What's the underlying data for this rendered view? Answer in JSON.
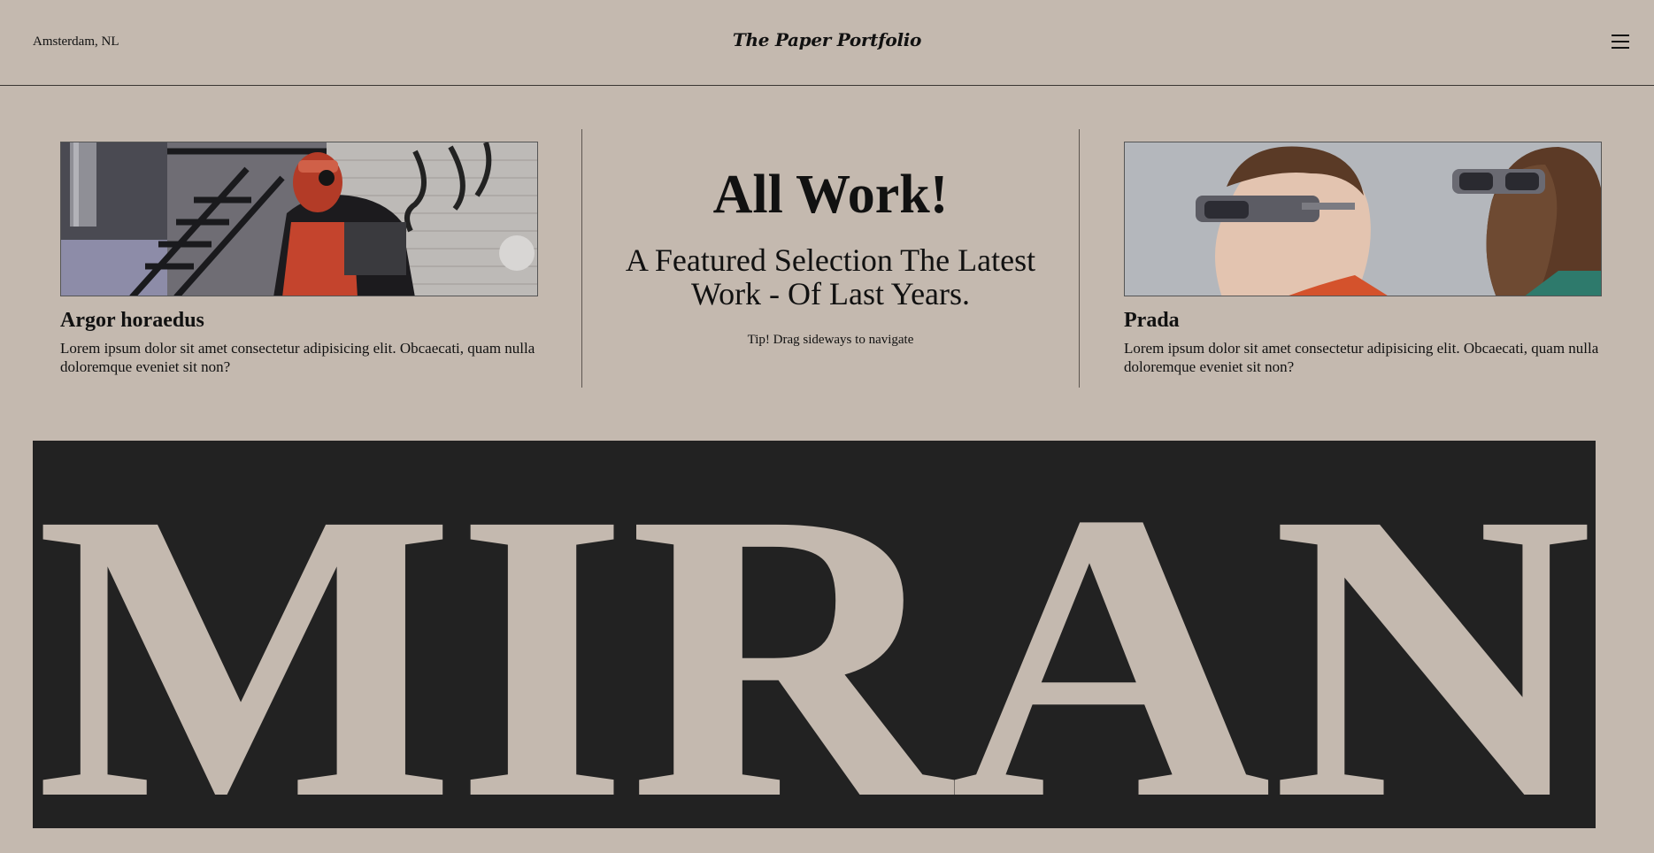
{
  "header": {
    "location": "Amsterdam, NL",
    "logo": "The Paper Portfolio",
    "menu_icon": "hamburger-menu-icon"
  },
  "featured_left": {
    "title": "Argor horaedus",
    "description": "Lorem ipsum dolor sit amet consectetur adipisicing elit. Obcaecati, quam nulla doloremque eveniet sit non?"
  },
  "center": {
    "heading": "All Work!",
    "subheading": "A Featured Selection The Latest Work - Of Last Years.",
    "tip": "Tip! Drag sideways to navigate"
  },
  "featured_right": {
    "title": "Prada",
    "description": "Lorem ipsum dolor sit amet consectetur adipisicing elit. Obcaecati, quam nulla doloremque eveniet sit non?"
  },
  "banner": {
    "text": "MIRAN"
  },
  "colors": {
    "background": "#c4b9af",
    "banner": "#222222",
    "text": "#111111"
  }
}
